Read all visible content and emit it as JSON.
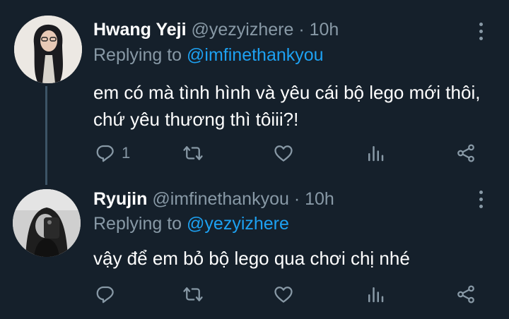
{
  "tweets": [
    {
      "name": "Hwang Yeji",
      "handle": "@yezyizhere",
      "separator": "·",
      "time": "10h",
      "replying_prefix": "Replying to",
      "replying_to": "@imfinethankyou",
      "text": "em có mà tình hình và yêu cái bộ lego mới thôi, chứ yêu thương thì tôiii?!",
      "reply_count": "1"
    },
    {
      "name": "Ryujin",
      "handle": "@imfinethankyou",
      "separator": "·",
      "time": "10h",
      "replying_prefix": "Replying to",
      "replying_to": "@yezyizhere",
      "text": "vậy để em bỏ bộ lego qua chơi chị nhé",
      "reply_count": ""
    }
  ],
  "colors": {
    "background": "#15202b",
    "secondary_text": "#8899a6",
    "link": "#1da1f2",
    "thread_line": "#3d5466"
  },
  "icons": [
    "reply-icon",
    "retweet-icon",
    "like-icon",
    "analytics-icon",
    "share-icon",
    "more-options-icon"
  ]
}
